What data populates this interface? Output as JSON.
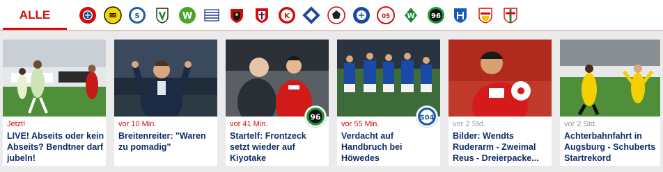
{
  "nav": {
    "alle_label": "ALLE",
    "accent_color": "#d40a0a",
    "clubs": [
      {
        "icon": "bayern-crest-icon"
      },
      {
        "icon": "dortmund-crest-icon"
      },
      {
        "icon": "schalke-crest-icon"
      },
      {
        "icon": "gladbach-crest-icon"
      },
      {
        "icon": "wolfsburg-crest-icon"
      },
      {
        "icon": "hertha-crest-icon"
      },
      {
        "icon": "leverkusen-crest-icon"
      },
      {
        "icon": "ingolstadt-crest-icon"
      },
      {
        "icon": "koeln-crest-icon"
      },
      {
        "icon": "hamburg-crest-icon"
      },
      {
        "icon": "frankfurt-crest-icon"
      },
      {
        "icon": "darmstadt-crest-icon"
      },
      {
        "icon": "mainz-crest-icon"
      },
      {
        "icon": "bremen-crest-icon"
      },
      {
        "icon": "hannover-crest-icon"
      },
      {
        "icon": "hoffenheim-crest-icon"
      },
      {
        "icon": "stuttgart-crest-icon"
      },
      {
        "icon": "augsburg-crest-icon"
      }
    ]
  },
  "news": [
    {
      "time": "Jetzt!",
      "title": "LIVE! Abseits oder kein Abseits? Bendtner darf jubeln!",
      "style": "live"
    },
    {
      "time": "vor 10 Min.",
      "title": "Breitenreiter: \"Waren zu pomadig\"",
      "style": "recent"
    },
    {
      "time": "vor 41 Min.",
      "title": "Startelf: Frontzeck setzt wieder auf Kiyotake",
      "style": "recent",
      "badge": "hannover-crest-icon"
    },
    {
      "time": "vor 55 Min.",
      "title": "Verdacht auf Handbruch bei Höwedes",
      "style": "recent",
      "badge": "schalke-crest-icon"
    },
    {
      "time": "vor 2 Std.",
      "title": "Bilder: Wendts Ruderarm - Zweimal Reus - Dreierpacke...",
      "style": "old"
    },
    {
      "time": "vor 2 Std.",
      "title": "Achterbahnfahrt in Augsburg - Schuberts Startrekord",
      "style": "old"
    }
  ]
}
